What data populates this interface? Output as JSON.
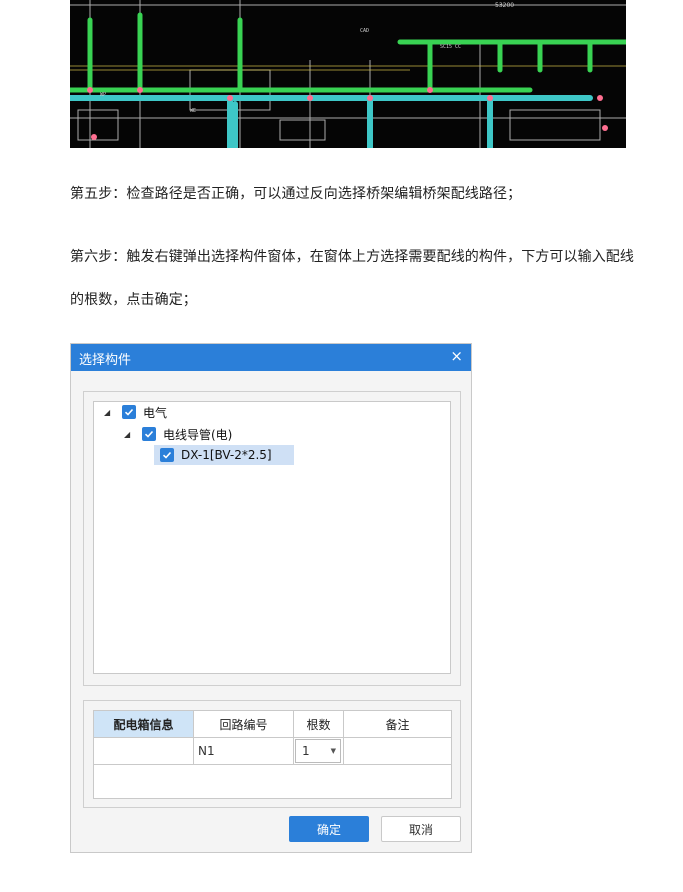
{
  "cad_image": {
    "dimension_text": "53200"
  },
  "step5": {
    "text": "第五步：检查路径是否正确，可以通过反向选择桥架编辑桥架配线路径；"
  },
  "step6": {
    "line1": "第六步：触发右键弹出选择构件窗体，在窗体上方选择需要配线的构件，下方可以输入配线",
    "line2": "的根数，点击确定；"
  },
  "dialog": {
    "title": "选择构件",
    "close_glyph": "×",
    "tree": [
      {
        "label": "电气",
        "checked": true,
        "expanded": true
      },
      {
        "label": "电线导管(电)",
        "checked": true,
        "expanded": true
      },
      {
        "label": "DX-1[BV-2*2.5]",
        "checked": true,
        "selected": true
      }
    ],
    "table": {
      "headers": [
        "配电箱信息",
        "回路编号",
        "根数",
        "备注"
      ],
      "row": {
        "box_info": "",
        "circuit_no": "N1",
        "count": "1",
        "note": ""
      }
    },
    "ok_label": "确定",
    "cancel_label": "取消"
  },
  "colors": {
    "accent": "#2b7fd9",
    "cad_background": "#050505",
    "pipe_green": "#39d353",
    "pipe_cyan": "#3ec7c7",
    "pipe_pink": "#ff6f91"
  }
}
